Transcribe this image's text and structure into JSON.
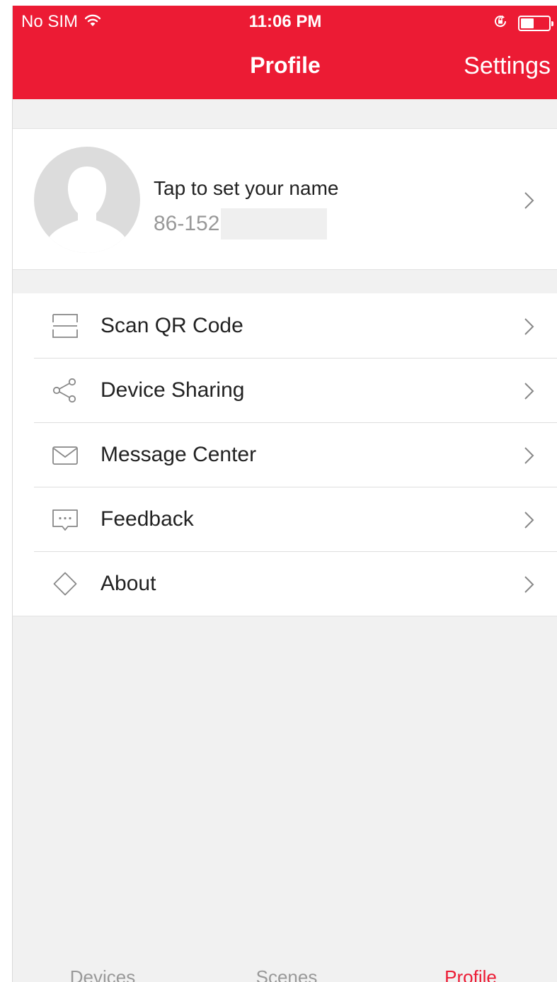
{
  "status_bar": {
    "carrier": "No SIM",
    "time": "11:06 PM",
    "wifi_icon": "wifi-icon",
    "lock_icon": "rotation-lock-icon",
    "battery_icon": "battery-icon"
  },
  "nav": {
    "title": "Profile",
    "settings_label": "Settings"
  },
  "profile": {
    "name_prompt": "Tap to set your name",
    "phone": "86-152",
    "avatar_icon": "default-avatar-icon"
  },
  "menu": {
    "items": [
      {
        "label": "Scan QR Code",
        "icon": "scan-qr-icon"
      },
      {
        "label": "Device Sharing",
        "icon": "share-icon"
      },
      {
        "label": "Message Center",
        "icon": "envelope-icon"
      },
      {
        "label": "Feedback",
        "icon": "chat-bubble-icon"
      },
      {
        "label": "About",
        "icon": "diamond-icon"
      }
    ]
  },
  "tabs": {
    "items": [
      {
        "label": "Devices"
      },
      {
        "label": "Scenes"
      },
      {
        "label": "Profile"
      }
    ],
    "active": "Profile"
  },
  "colors": {
    "brand_red": "#ec1b34",
    "background": "#f1f1f1",
    "text_primary": "#222222",
    "text_secondary": "#999999"
  }
}
